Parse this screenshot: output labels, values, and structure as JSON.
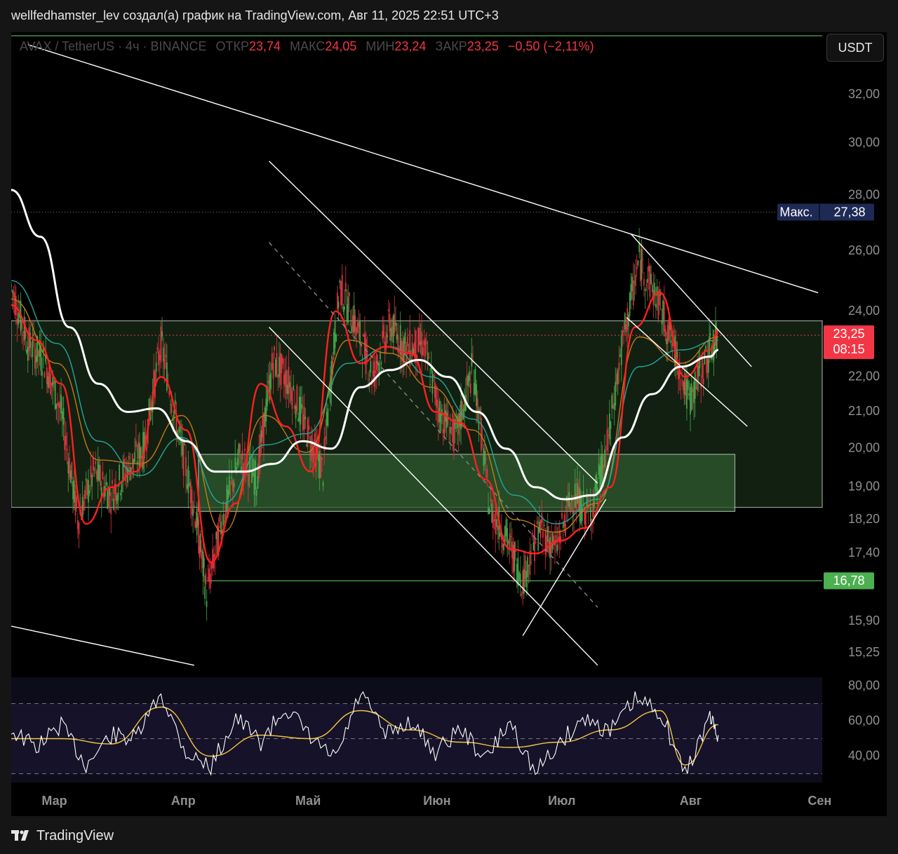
{
  "header": {
    "title": "wellfedhamster_lev создал(а) график на TradingView.com, Авг 11, 2025 22:51 UTC+3"
  },
  "legend": {
    "symbol": "AVAX / TetherUS · 4ч · BINANCE",
    "open_label": "ОТКР",
    "open": "23,74",
    "high_label": "МАКС",
    "high": "24,05",
    "low_label": "МИН",
    "low": "23,24",
    "close_label": "ЗАКР",
    "close": "23,25",
    "change": "−0,50 (−2,11%)"
  },
  "currency_button": "USDT",
  "colors": {
    "background": "#000000",
    "up": "#4caf50",
    "down": "#f23645",
    "zone": "#1f3a1f",
    "inner_zone": "#2e5a2e",
    "ma_white": "#ffffff",
    "ema_red": "#ff2020",
    "ema_teal": "#26a69a",
    "ema_orange": "#c27a1a",
    "rsi_bg": "#0d0c1a",
    "rsi_line": "#ffffff",
    "rsi_signal": "#f5c542"
  },
  "chart_data": {
    "type": "line",
    "title": "AVAX / TetherUS · 4ч · BINANCE",
    "price_axis": {
      "ticks": [
        "32,00",
        "30,00",
        "28,00",
        "26,00",
        "24,00",
        "22,00",
        "21,00",
        "20,00",
        "19,00",
        "18,20",
        "17,40",
        "15,90",
        "15,25"
      ],
      "tick_values": [
        32.0,
        30.0,
        28.0,
        26.0,
        24.0,
        22.0,
        21.0,
        20.0,
        19.0,
        18.2,
        17.4,
        15.9,
        15.25
      ],
      "scale": "log",
      "range": [
        14.9,
        34.0
      ]
    },
    "rsi_axis": {
      "ticks": [
        "80,00",
        "60,00",
        "40,00"
      ],
      "tick_values": [
        80,
        60,
        40
      ],
      "bands": [
        70,
        50,
        30
      ],
      "range": [
        25,
        85
      ]
    },
    "time_axis": {
      "labels": [
        "Мар",
        "Апр",
        "Май",
        "Июн",
        "Июл",
        "Авг",
        "Сен"
      ],
      "dates": [
        "2025-03-01",
        "2025-04-01",
        "2025-05-01",
        "2025-06-01",
        "2025-07-01",
        "2025-08-01",
        "2025-09-01"
      ],
      "range": [
        "2025-02-22",
        "2025-09-05"
      ]
    },
    "price_series": {
      "name": "AVAX / TetherUS",
      "x": [
        "2025-02-22",
        "2025-02-26",
        "2025-03-02",
        "2025-03-06",
        "2025-03-10",
        "2025-03-14",
        "2025-03-18",
        "2025-03-22",
        "2025-03-26",
        "2025-03-30",
        "2025-04-03",
        "2025-04-07",
        "2025-04-10",
        "2025-04-14",
        "2025-04-18",
        "2025-04-22",
        "2025-04-26",
        "2025-04-30",
        "2025-05-04",
        "2025-05-08",
        "2025-05-12",
        "2025-05-16",
        "2025-05-20",
        "2025-05-24",
        "2025-05-28",
        "2025-06-01",
        "2025-06-05",
        "2025-06-09",
        "2025-06-13",
        "2025-06-17",
        "2025-06-21",
        "2025-06-25",
        "2025-06-29",
        "2025-07-03",
        "2025-07-07",
        "2025-07-11",
        "2025-07-15",
        "2025-07-19",
        "2025-07-23",
        "2025-07-27",
        "2025-07-31",
        "2025-08-04",
        "2025-08-08",
        "2025-08-11"
      ],
      "y": [
        24.8,
        23.0,
        22.5,
        21.0,
        18.2,
        19.4,
        18.8,
        19.5,
        20.0,
        23.0,
        20.5,
        18.5,
        16.5,
        18.3,
        19.8,
        19.2,
        22.5,
        21.8,
        20.5,
        19.4,
        24.8,
        23.5,
        22.0,
        23.6,
        22.8,
        23.0,
        21.0,
        20.3,
        22.3,
        18.5,
        17.8,
        16.8,
        18.0,
        17.5,
        18.8,
        18.3,
        19.8,
        23.0,
        25.7,
        24.5,
        23.0,
        21.3,
        22.5,
        23.25
      ]
    },
    "ma_white": {
      "name": "MA",
      "x": [
        "2025-02-22",
        "2025-03-01",
        "2025-03-08",
        "2025-03-15",
        "2025-03-22",
        "2025-03-29",
        "2025-04-05",
        "2025-04-12",
        "2025-04-19",
        "2025-04-26",
        "2025-05-03",
        "2025-05-10",
        "2025-05-17",
        "2025-05-24",
        "2025-05-31",
        "2025-06-07",
        "2025-06-14",
        "2025-06-21",
        "2025-06-28",
        "2025-07-05",
        "2025-07-12",
        "2025-07-19",
        "2025-07-26",
        "2025-08-02",
        "2025-08-09",
        "2025-08-11"
      ],
      "y": [
        28.2,
        26.5,
        23.5,
        21.8,
        21.0,
        21.1,
        20.2,
        19.4,
        19.4,
        19.6,
        20.2,
        20.0,
        21.7,
        22.2,
        22.5,
        22.0,
        21.0,
        20.0,
        19.0,
        18.7,
        18.8,
        20.3,
        21.5,
        22.3,
        22.6,
        22.8
      ]
    },
    "ema_red": {
      "name": "EMA",
      "x": [
        "2025-02-22",
        "2025-02-28",
        "2025-03-06",
        "2025-03-12",
        "2025-03-18",
        "2025-03-24",
        "2025-03-30",
        "2025-04-05",
        "2025-04-11",
        "2025-04-17",
        "2025-04-23",
        "2025-04-29",
        "2025-05-05",
        "2025-05-11",
        "2025-05-17",
        "2025-05-23",
        "2025-05-29",
        "2025-06-04",
        "2025-06-10",
        "2025-06-16",
        "2025-06-22",
        "2025-06-28",
        "2025-07-04",
        "2025-07-10",
        "2025-07-16",
        "2025-07-22",
        "2025-07-28",
        "2025-08-03",
        "2025-08-09",
        "2025-08-11"
      ],
      "y": [
        24.2,
        23.1,
        21.8,
        18.1,
        19.0,
        19.4,
        22.0,
        20.5,
        17.2,
        18.6,
        21.8,
        20.6,
        19.4,
        24.0,
        22.4,
        22.9,
        22.7,
        21.0,
        20.7,
        19.2,
        17.5,
        17.4,
        17.7,
        18.0,
        19.0,
        23.5,
        24.6,
        22.0,
        22.8,
        23.4
      ]
    },
    "ema_teal": {
      "name": "EMA",
      "x": [
        "2025-02-22",
        "2025-03-05",
        "2025-03-15",
        "2025-03-25",
        "2025-04-04",
        "2025-04-14",
        "2025-04-24",
        "2025-05-04",
        "2025-05-14",
        "2025-05-24",
        "2025-06-03",
        "2025-06-13",
        "2025-06-23",
        "2025-07-03",
        "2025-07-13",
        "2025-07-23",
        "2025-08-02",
        "2025-08-11"
      ],
      "y": [
        25.0,
        23.0,
        20.2,
        19.3,
        20.3,
        18.6,
        20.1,
        20.4,
        22.4,
        22.9,
        22.0,
        20.8,
        18.8,
        18.1,
        18.7,
        22.3,
        22.8,
        23.1
      ]
    },
    "ema_orange": {
      "name": "EMA",
      "x": [
        "2025-02-22",
        "2025-03-05",
        "2025-03-15",
        "2025-03-25",
        "2025-04-04",
        "2025-04-14",
        "2025-04-24",
        "2025-05-04",
        "2025-05-14",
        "2025-05-24",
        "2025-06-03",
        "2025-06-13",
        "2025-06-23",
        "2025-07-03",
        "2025-07-13",
        "2025-07-23",
        "2025-08-02",
        "2025-08-11"
      ],
      "y": [
        24.4,
        22.4,
        19.7,
        19.6,
        20.9,
        17.9,
        20.9,
        19.9,
        23.1,
        22.7,
        21.7,
        20.5,
        18.2,
        17.9,
        18.6,
        23.2,
        22.4,
        23.2
      ]
    },
    "rsi": {
      "x": [
        "2025-02-22",
        "2025-02-28",
        "2025-03-06",
        "2025-03-12",
        "2025-03-18",
        "2025-03-24",
        "2025-03-30",
        "2025-04-05",
        "2025-04-11",
        "2025-04-17",
        "2025-04-23",
        "2025-04-29",
        "2025-05-05",
        "2025-05-11",
        "2025-05-17",
        "2025-05-23",
        "2025-05-29",
        "2025-06-04",
        "2025-06-10",
        "2025-06-16",
        "2025-06-22",
        "2025-06-28",
        "2025-07-04",
        "2025-07-10",
        "2025-07-16",
        "2025-07-22",
        "2025-07-28",
        "2025-08-03",
        "2025-08-09",
        "2025-08-11"
      ],
      "y": [
        55,
        45,
        58,
        35,
        52,
        50,
        76,
        42,
        34,
        62,
        48,
        68,
        50,
        38,
        76,
        52,
        60,
        42,
        56,
        38,
        60,
        30,
        48,
        62,
        54,
        72,
        66,
        30,
        62,
        52
      ]
    },
    "rsi_signal": {
      "x": [
        "2025-02-22",
        "2025-03-06",
        "2025-03-18",
        "2025-03-30",
        "2025-04-11",
        "2025-04-23",
        "2025-05-05",
        "2025-05-17",
        "2025-05-29",
        "2025-06-10",
        "2025-06-22",
        "2025-07-04",
        "2025-07-16",
        "2025-07-28",
        "2025-08-03",
        "2025-08-11"
      ],
      "y": [
        50,
        50,
        47,
        68,
        40,
        52,
        50,
        66,
        55,
        48,
        45,
        48,
        55,
        66,
        35,
        58
      ]
    },
    "zones": [
      {
        "name": "large-demand-zone",
        "y_range": [
          18.5,
          23.7
        ],
        "x_range": [
          "2025-02-22",
          "2025-09-05"
        ]
      },
      {
        "name": "inner-zone",
        "y_range": [
          18.4,
          19.85
        ],
        "x_range": [
          "2025-04-08",
          "2025-08-15"
        ]
      }
    ],
    "horizontal_levels": [
      {
        "name": "support",
        "value": 16.78,
        "label": "16,78",
        "x_start": "2025-04-10"
      },
      {
        "name": "current-price",
        "value": 23.25,
        "label": "23,25",
        "countdown": "08:15"
      },
      {
        "name": "high-marker",
        "value": 27.38,
        "label_prefix": "Макс.",
        "label": "27,38"
      }
    ],
    "trendlines": [
      {
        "name": "major-downtrend",
        "points": [
          [
            "2025-02-26",
            34.2
          ],
          [
            "2025-09-04",
            24.6
          ]
        ]
      },
      {
        "name": "lower-left-line",
        "points": [
          [
            "2025-02-22",
            15.8
          ],
          [
            "2025-04-07",
            15.0
          ]
        ]
      },
      {
        "name": "channel-upper",
        "points": [
          [
            "2025-04-25",
            29.3
          ],
          [
            "2025-07-13",
            19.1
          ]
        ]
      },
      {
        "name": "channel-lower",
        "points": [
          [
            "2025-04-25",
            23.5
          ],
          [
            "2025-07-13",
            15.0
          ]
        ]
      },
      {
        "name": "channel-mid-dashed",
        "points": [
          [
            "2025-04-25",
            26.3
          ],
          [
            "2025-07-13",
            16.2
          ]
        ]
      },
      {
        "name": "rising-support",
        "points": [
          [
            "2025-06-25",
            15.6
          ],
          [
            "2025-07-15",
            18.7
          ]
        ]
      },
      {
        "name": "wedge-upper",
        "points": [
          [
            "2025-07-21",
            26.6
          ],
          [
            "2025-08-19",
            22.3
          ]
        ]
      },
      {
        "name": "wedge-lower",
        "points": [
          [
            "2025-07-20",
            23.8
          ],
          [
            "2025-08-18",
            20.6
          ]
        ]
      }
    ]
  }
}
